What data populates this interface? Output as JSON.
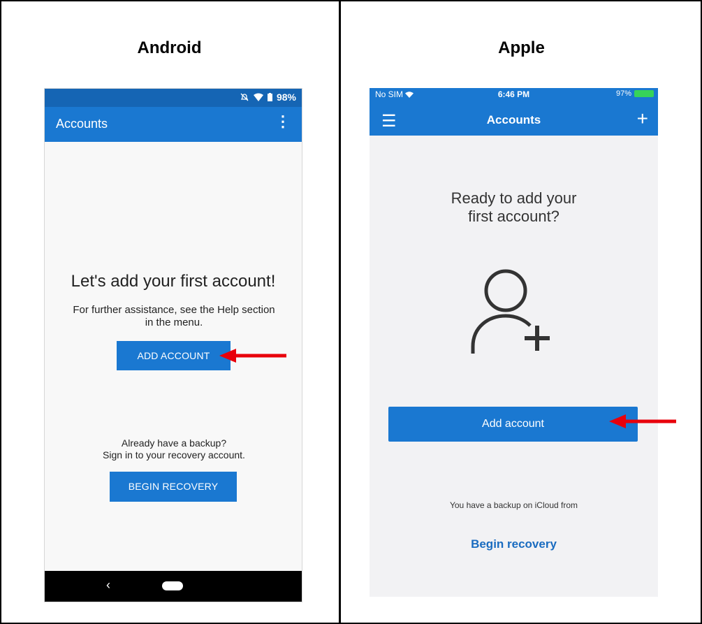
{
  "columns": {
    "left_title": "Android",
    "right_title": "Apple"
  },
  "android": {
    "status": {
      "battery": "98%",
      "icons": [
        "bell-off-icon",
        "wifi-icon",
        "battery-icon"
      ]
    },
    "appbar": {
      "title": "Accounts",
      "menu_icon": "more-vertical-icon"
    },
    "heading": "Let's add your first account!",
    "help_text": "For further assistance, see the Help section in the menu.",
    "add_button": "ADD ACCOUNT",
    "backup_text_1": "Already have a backup?",
    "backup_text_2": "Sign in to your recovery account.",
    "recovery_button": "BEGIN RECOVERY",
    "nav": {
      "back_icon": "back-icon",
      "home_icon": "home-pill-icon"
    }
  },
  "apple": {
    "status": {
      "carrier": "No SIM",
      "time": "6:46 PM",
      "battery": "97%"
    },
    "header": {
      "title": "Accounts",
      "menu_icon": "hamburger-icon",
      "add_icon": "plus-icon"
    },
    "ready_line_1": "Ready to add your",
    "ready_line_2": "first account?",
    "add_button": "Add account",
    "backup_text": "You have a backup on iCloud from",
    "recovery_link": "Begin recovery"
  },
  "colors": {
    "accent": "#1a78d1",
    "statusbar": "#1565b4",
    "arrow": "#e8000b"
  }
}
